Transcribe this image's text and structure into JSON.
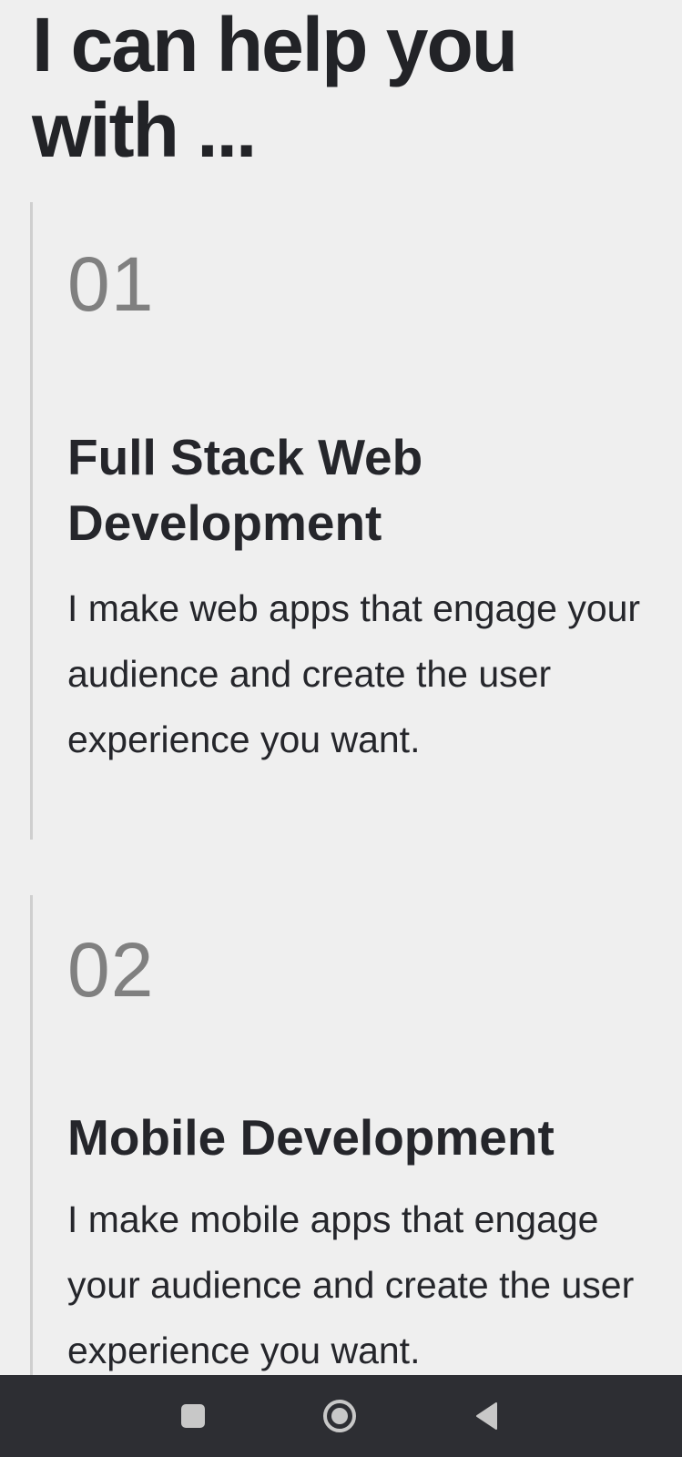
{
  "heading": "I can help you with ...",
  "services": [
    {
      "number": "01",
      "title": "Full Stack Web Development",
      "description": "I make web apps that engage your audience and create the user experience you want."
    },
    {
      "number": "02",
      "title": "Mobile Development",
      "description": "I make mobile apps that engage your audience and create the user experience you want."
    }
  ],
  "navbar": {
    "background": "#2d2e33",
    "icon_color": "#c8c8c8",
    "icons": [
      "recent-apps-icon",
      "home-icon",
      "back-icon"
    ]
  }
}
